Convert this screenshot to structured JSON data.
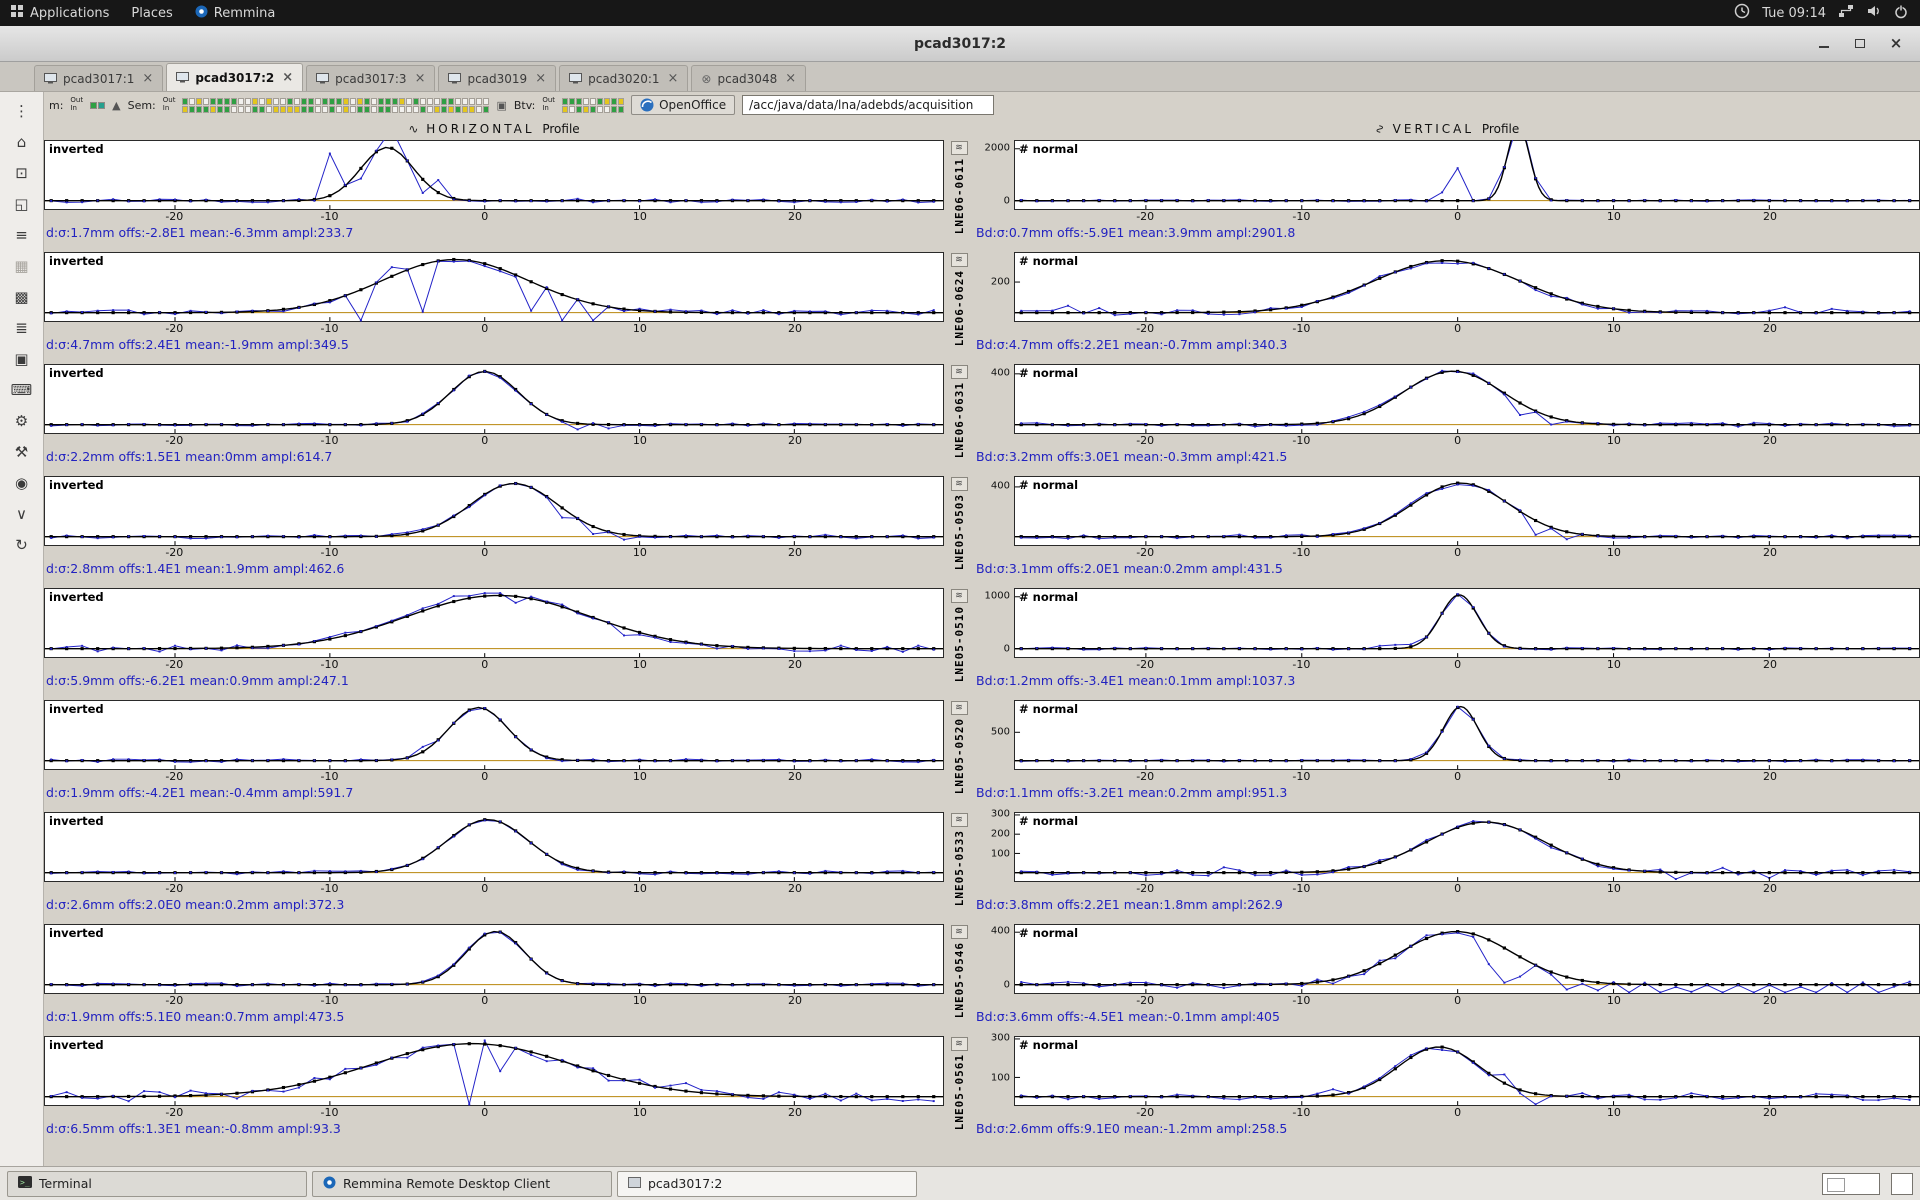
{
  "host_panel": {
    "menus": [
      {
        "label": "Applications",
        "icon": "apps"
      },
      {
        "label": "Places",
        "icon": "none"
      },
      {
        "label": "Remmina",
        "icon": "remmina"
      }
    ],
    "clock": "Tue 09:14"
  },
  "window": {
    "title": "pcad3017:2"
  },
  "tabs": [
    {
      "label": "pcad3017:1",
      "icon": "monitor",
      "active": false
    },
    {
      "label": "pcad3017:2",
      "icon": "monitor",
      "active": true
    },
    {
      "label": "pcad3017:3",
      "icon": "monitor",
      "active": false
    },
    {
      "label": "pcad3019",
      "icon": "monitor",
      "active": false
    },
    {
      "label": "pcad3020:1",
      "icon": "monitor",
      "active": false
    },
    {
      "label": "pcad3048",
      "icon": "closed",
      "active": false
    }
  ],
  "remmina_toolbar": [
    {
      "name": "drag-handle-icon",
      "glyph": "⋮",
      "disabled": false
    },
    {
      "name": "screen-icon",
      "glyph": "⌂",
      "disabled": false
    },
    {
      "name": "fit-window-icon",
      "glyph": "⊡",
      "disabled": false
    },
    {
      "name": "fullscreen-icon",
      "glyph": "◱",
      "disabled": false
    },
    {
      "name": "menu-icon",
      "glyph": "≡",
      "disabled": false
    },
    {
      "name": "multi-monitor-icon",
      "glyph": "▦",
      "disabled": true
    },
    {
      "name": "dynamic-resolution-icon",
      "glyph": "▩",
      "disabled": false
    },
    {
      "name": "scaled-mode-icon",
      "glyph": "≣",
      "disabled": false
    },
    {
      "name": "window-mode-icon",
      "glyph": "▣",
      "disabled": false
    },
    {
      "name": "keyboard-grab-icon",
      "glyph": "⌨",
      "disabled": false
    },
    {
      "name": "preferences-icon",
      "glyph": "⚙",
      "disabled": false
    },
    {
      "name": "tools-icon",
      "glyph": "⚒",
      "disabled": false
    },
    {
      "name": "screenshot-icon",
      "glyph": "◉",
      "disabled": false
    },
    {
      "name": "minimize-icon",
      "glyph": "∨",
      "disabled": false
    },
    {
      "name": "disconnect-icon",
      "glyph": "↻",
      "disabled": false
    }
  ],
  "remote_toolbar": {
    "m_label": "m:",
    "out_label": "Out",
    "in_label": "In",
    "sem_label": "Sem:",
    "btv_label": "Btv:",
    "openoffice_label": "OpenOffice",
    "path": "/acc/java/data/lna/adebds/acquisition",
    "sem_strip": {
      "cols": 44,
      "rows": 2
    },
    "btv_strip": {
      "cols": 9,
      "rows": 2
    },
    "cell_colors": {
      "empty": "#f2f1ee",
      "green": "#2fa043",
      "yellow": "#e3c61d"
    }
  },
  "headers": {
    "horizontal_title": "HORIZONTAL",
    "horizontal_sub": "Profile",
    "vertical_title": "VERTICAL",
    "vertical_sub": "Profile"
  },
  "taskbar": {
    "windows": [
      {
        "label": "Terminal",
        "icon": "terminal",
        "active": false
      },
      {
        "label": "Remmina Remote Desktop Client",
        "icon": "remmina",
        "active": false
      },
      {
        "label": "pcad3017:2",
        "icon": "pcad",
        "active": true
      }
    ]
  },
  "chart_data": {
    "type": "line",
    "x_ticks": [
      -20,
      -10,
      0,
      10,
      20
    ],
    "x_range": [
      -28.4,
      29.6
    ],
    "colors": {
      "fit": "#000000",
      "raw": "#2222c8",
      "baseline": "#b8860b"
    },
    "rows": [
      {
        "device": "LNE06-0611",
        "horizontal": {
          "label": "inverted",
          "stats": "d:σ:1.7mm offs:-2.8E1 mean:-6.3mm ampl:233.7",
          "sigma": 1.7,
          "mean": -6.3,
          "ampl": 233.7,
          "ymax": 262,
          "noise": 0.035,
          "spikes": [
            [
              -10,
              185
            ],
            [
              -8,
              -45
            ],
            [
              -6,
              85
            ],
            [
              -4,
              -60
            ],
            [
              -3,
              55
            ]
          ],
          "yticks": []
        },
        "vertical": {
          "label": "# normal",
          "stats": "Bd:σ:0.7mm offs:-5.9E1 mean:3.9mm ampl:2901.8",
          "sigma": 0.7,
          "mean": 3.9,
          "ampl": 2901.8,
          "ymax": 2300,
          "noise": 0.012,
          "spikes": [
            [
              -1,
              320
            ],
            [
              0,
              1250
            ],
            [
              4,
              430
            ]
          ],
          "yticks": [
            2000,
            0
          ]
        }
      },
      {
        "device": "LNE06-0624",
        "horizontal": {
          "label": "inverted",
          "stats": "d:σ:4.7mm offs:2.4E1 mean:-1.9mm ampl:349.5",
          "sigma": 4.7,
          "mean": -1.9,
          "ampl": 349.5,
          "ymax": 392,
          "noise": 0.05,
          "spikes": [
            [
              -8,
              -285
            ],
            [
              -6,
              60
            ],
            [
              -4,
              -310
            ],
            [
              3,
              -190
            ],
            [
              5,
              -320
            ],
            [
              7,
              -120
            ]
          ],
          "yticks": []
        },
        "vertical": {
          "label": "# normal",
          "stats": "Bd:σ:4.7mm offs:2.2E1 mean:-0.7mm ampl:340.3",
          "sigma": 4.7,
          "mean": -0.7,
          "ampl": 340.3,
          "ymax": 390,
          "noise": 0.05,
          "spikes": [
            [
              -25,
              45
            ],
            [
              -23,
              30
            ],
            [
              21,
              35
            ],
            [
              24,
              25
            ]
          ],
          "yticks": [
            200
          ]
        }
      },
      {
        "device": "LNE06-0631",
        "horizontal": {
          "label": "inverted",
          "stats": "d:σ:2.2mm offs:1.5E1 mean:0mm ampl:614.7",
          "sigma": 2.2,
          "mean": 0,
          "ampl": 614.7,
          "ymax": 689,
          "noise": 0.025,
          "spikes": [
            [
              6,
              -70
            ],
            [
              8,
              -45
            ]
          ],
          "yticks": []
        },
        "vertical": {
          "label": "# normal",
          "stats": "Bd:σ:3.2mm offs:3.0E1 mean:-0.3mm ampl:421.5",
          "sigma": 3.2,
          "mean": -0.3,
          "ampl": 421.5,
          "ymax": 470,
          "noise": 0.04,
          "spikes": [
            [
              4,
              -95
            ],
            [
              6,
              -60
            ]
          ],
          "yticks": [
            400
          ]
        }
      },
      {
        "device": "LNE05-0503",
        "horizontal": {
          "label": "inverted",
          "stats": "d:σ:2.8mm offs:1.4E1 mean:1.9mm ampl:462.6",
          "sigma": 2.8,
          "mean": 1.9,
          "ampl": 462.6,
          "ymax": 519,
          "noise": 0.035,
          "spikes": [
            [
              5,
              -85
            ],
            [
              7,
              -65
            ],
            [
              9,
              -45
            ]
          ],
          "yticks": []
        },
        "vertical": {
          "label": "# normal",
          "stats": "Bd:σ:3.1mm offs:2.0E1 mean:0.2mm ampl:431.5",
          "sigma": 3.1,
          "mean": 0.2,
          "ampl": 431.5,
          "ymax": 480,
          "noise": 0.04,
          "spikes": [
            [
              5,
              -115
            ],
            [
              7,
              -60
            ]
          ],
          "yticks": [
            400
          ]
        }
      },
      {
        "device": "LNE05-0510",
        "horizontal": {
          "label": "inverted",
          "stats": "d:σ:5.9mm offs:-6.2E1 mean:0.9mm ampl:247.1",
          "sigma": 5.9,
          "mean": 0.9,
          "ampl": 247.1,
          "ymax": 277,
          "noise": 0.06,
          "spikes": [
            [
              -2,
              25
            ],
            [
              2,
              -30
            ],
            [
              9,
              -35
            ]
          ],
          "yticks": []
        },
        "vertical": {
          "label": "# normal",
          "stats": "Bd:σ:1.2mm offs:-3.4E1 mean:0.1mm ampl:1037.3",
          "sigma": 1.2,
          "mean": 0.1,
          "ampl": 1037.3,
          "ymax": 1150,
          "noise": 0.02,
          "spikes": [
            [
              -5,
              55
            ],
            [
              -4,
              70
            ],
            [
              -3,
              45
            ]
          ],
          "yticks": [
            1000,
            0
          ]
        }
      },
      {
        "device": "LNE05-0520",
        "horizontal": {
          "label": "inverted",
          "stats": "d:σ:1.9mm offs:-4.2E1 mean:-0.4mm ampl:591.7",
          "sigma": 1.9,
          "mean": -0.4,
          "ampl": 591.7,
          "ymax": 663,
          "noise": 0.03,
          "spikes": [
            [
              -4,
              55
            ]
          ],
          "yticks": []
        },
        "vertical": {
          "label": "# normal",
          "stats": "Bd:σ:1.1mm offs:-3.2E1 mean:0.2mm ampl:951.3",
          "sigma": 1.1,
          "mean": 0.2,
          "ampl": 951.3,
          "ymax": 1050,
          "noise": 0.02,
          "spikes": [],
          "yticks": [
            500
          ]
        }
      },
      {
        "device": "LNE05-0533",
        "horizontal": {
          "label": "inverted",
          "stats": "d:σ:2.6mm offs:2.0E0 mean:0.2mm ampl:372.3",
          "sigma": 2.6,
          "mean": 0.2,
          "ampl": 372.3,
          "ymax": 418,
          "noise": 0.035,
          "spikes": [],
          "yticks": []
        },
        "vertical": {
          "label": "# normal",
          "stats": "Bd:σ:3.8mm offs:2.2E1 mean:1.8mm ampl:262.9",
          "sigma": 3.8,
          "mean": 1.8,
          "ampl": 262.9,
          "ymax": 310,
          "noise": 0.06,
          "spikes": [
            [
              -15,
              28
            ],
            [
              14,
              -35
            ],
            [
              17,
              25
            ],
            [
              20,
              -28
            ]
          ],
          "yticks": [
            300,
            200,
            100
          ]
        }
      },
      {
        "device": "LNE05-0546",
        "horizontal": {
          "label": "inverted",
          "stats": "d:σ:1.9mm offs:5.1E0 mean:0.7mm ampl:473.5",
          "sigma": 1.9,
          "mean": 0.7,
          "ampl": 473.5,
          "ymax": 531,
          "noise": 0.03,
          "spikes": [],
          "yticks": []
        },
        "vertical": {
          "label": "# normal",
          "stats": "Bd:σ:3.6mm offs:-4.5E1 mean:-0.1mm ampl:405",
          "sigma": 3.6,
          "mean": -0.1,
          "ampl": 405,
          "ymax": 455,
          "noise": 0.07,
          "spikes": [
            [
              2,
              -185
            ],
            [
              3,
              -265
            ],
            [
              4,
              -150
            ],
            [
              7,
              -95
            ],
            [
              9,
              -60
            ],
            [
              11,
              -75
            ],
            [
              13,
              -105
            ],
            [
              15,
              -55
            ],
            [
              17,
              -80
            ],
            [
              19,
              -115
            ],
            [
              21,
              -70
            ],
            [
              23,
              -95
            ],
            [
              25,
              -125
            ],
            [
              27,
              -70
            ]
          ],
          "yticks": [
            400,
            0
          ]
        }
      },
      {
        "device": "LNE05-0561",
        "horizontal": {
          "label": "inverted",
          "stats": "d:σ:6.5mm offs:1.3E1 mean:-0.8mm ampl:93.3",
          "sigma": 6.5,
          "mean": -0.8,
          "ampl": 93.3,
          "ymax": 105,
          "noise": 0.1,
          "spikes": [
            [
              -1,
              -115
            ],
            [
              1,
              -45
            ],
            [
              13,
              14
            ]
          ],
          "yticks": []
        },
        "vertical": {
          "label": "# normal",
          "stats": "Bd:σ:2.6mm offs:9.1E0 mean:-1.2mm ampl:258.5",
          "sigma": 2.6,
          "mean": -1.2,
          "ampl": 258.5,
          "ymax": 310,
          "noise": 0.07,
          "spikes": [
            [
              -8,
              30
            ],
            [
              3,
              45
            ],
            [
              5,
              -55
            ]
          ],
          "yticks": [
            300,
            100
          ]
        }
      }
    ]
  }
}
